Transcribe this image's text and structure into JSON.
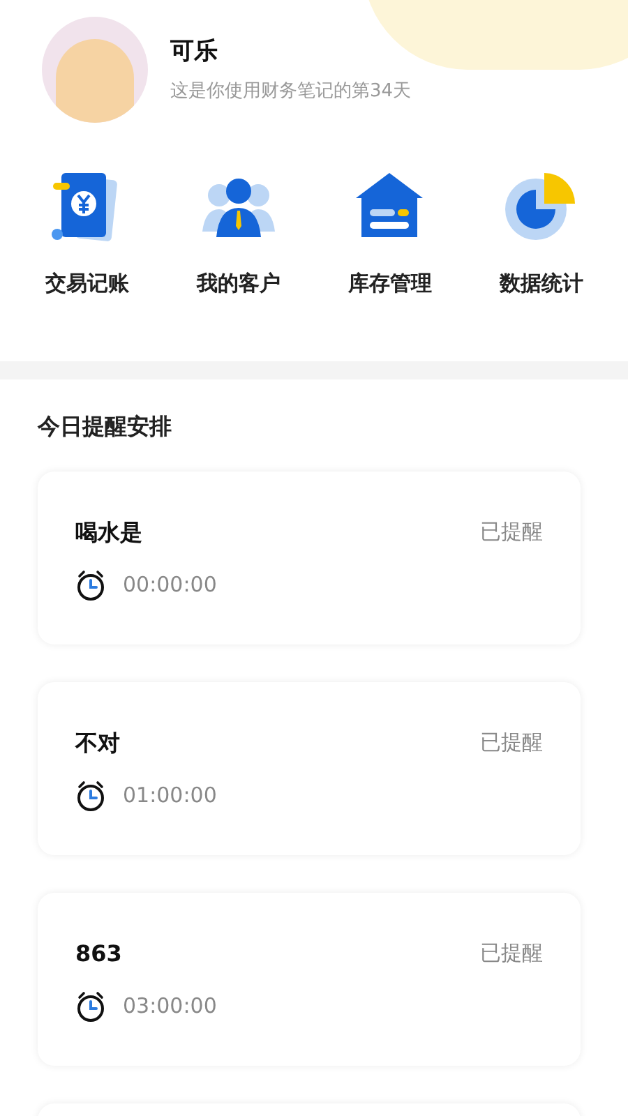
{
  "profile": {
    "name": "可乐",
    "subtitle": "这是你使用财务笔记的第34天"
  },
  "shortcuts": [
    {
      "kind": "ledger",
      "label": "交易记账"
    },
    {
      "kind": "customers",
      "label": "我的客户"
    },
    {
      "kind": "inventory",
      "label": "库存管理"
    },
    {
      "kind": "stats",
      "label": "数据统计"
    }
  ],
  "reminders": {
    "title": "今日提醒安排",
    "items": [
      {
        "title": "喝水是",
        "status": "已提醒",
        "time": "00:00:00"
      },
      {
        "title": "不对",
        "status": "已提醒",
        "time": "01:00:00"
      },
      {
        "title": "863",
        "status": "已提醒",
        "time": "03:00:00"
      }
    ]
  }
}
